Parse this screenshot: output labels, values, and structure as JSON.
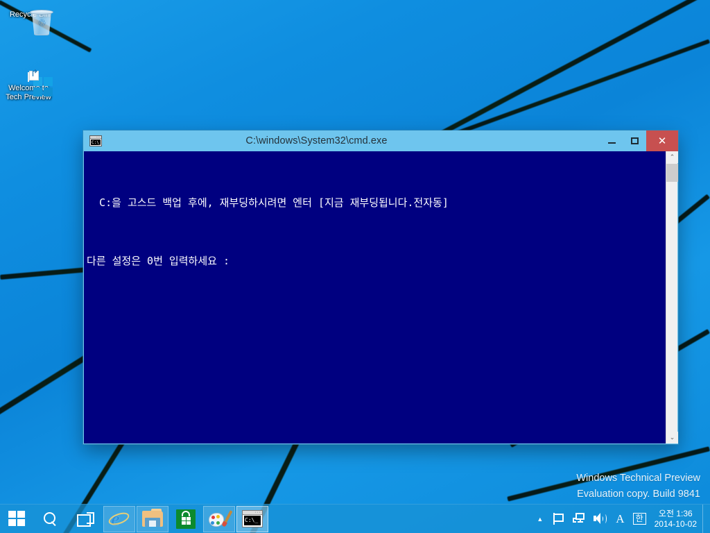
{
  "desktop": {
    "icons": [
      {
        "name": "recycle-bin",
        "label": "Recycle Bin"
      },
      {
        "name": "welcome-tech-preview",
        "label_line1": "Welcome to",
        "label_line2": "Tech Preview"
      }
    ],
    "watermark": {
      "line1": "Windows Technical Preview",
      "line2": "Evaluation copy. Build 9841"
    },
    "wallpaper_color": "#0f8ee0"
  },
  "cmd_window": {
    "title": "C:\\windows\\System32\\cmd.exe",
    "icon_text": "C:\\_",
    "controls": {
      "minimize": "–",
      "maximize": "□",
      "close": "✕",
      "close_color": "#c75050"
    },
    "console": {
      "background_color": "#000080",
      "foreground_color": "#ffffff",
      "lines": [
        "  C:을 고스드 백업 후에, 재부딩하시려면 엔터 [지금 재부딩됩니다.전자동]",
        "다른 설정은 0번 입력하세요 :"
      ]
    },
    "scrollbar": {
      "up_arrow": "⌃",
      "down_arrow": "⌄"
    }
  },
  "taskbar": {
    "start_label": "Start",
    "items": [
      {
        "name": "search",
        "label": "Search"
      },
      {
        "name": "task-view",
        "label": "Task View"
      },
      {
        "name": "internet-explorer",
        "label": "Internet Explorer",
        "state": "pinned"
      },
      {
        "name": "file-explorer",
        "label": "File Explorer",
        "state": "pinned"
      },
      {
        "name": "store",
        "label": "Store",
        "state": "pinned"
      },
      {
        "name": "paint",
        "label": "Paint",
        "state": "pinned"
      },
      {
        "name": "cmd",
        "label": "C:\\windows\\System32\\cmd.exe",
        "state": "active",
        "icon_text": "C:\\_"
      }
    ],
    "tray": {
      "chevron": "▲",
      "action_center": "Action Center",
      "network": "Network",
      "volume": "Volume",
      "ime_mode": "A",
      "ime_lang": "한",
      "clock_time": "오전 1:36",
      "clock_date": "2014-10-02"
    }
  }
}
